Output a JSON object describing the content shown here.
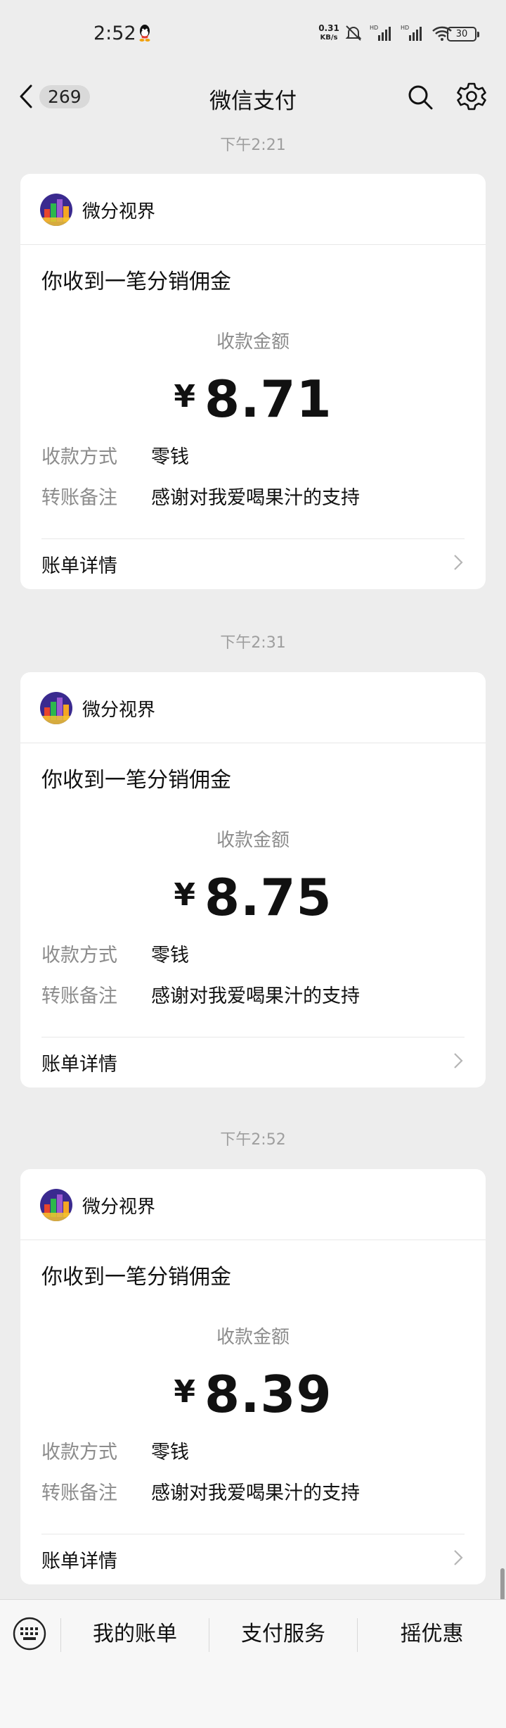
{
  "status_bar": {
    "time": "2:52",
    "net_speed_value": "0.31",
    "net_speed_unit": "KB/s",
    "battery": "30",
    "icons": [
      "qq-icon",
      "mute-icon",
      "hd-signal-icon",
      "hd-signal-icon",
      "wifi-icon",
      "battery-icon"
    ]
  },
  "nav": {
    "unread_count": "269",
    "title": "微信支付",
    "icons": [
      "back-arrow-icon",
      "search-icon",
      "gear-icon"
    ]
  },
  "messages": [
    {
      "timestamp": "下午2:21",
      "merchant": "微分视界",
      "title": "你收到一笔分销佣金",
      "amount_label": "收款金额",
      "currency": "¥",
      "amount": "8.71",
      "method_label": "收款方式",
      "method_value": "零钱",
      "note_label": "转账备注",
      "note_value": "感谢对我爱喝果汁的支持",
      "detail_label": "账单详情"
    },
    {
      "timestamp": "下午2:31",
      "merchant": "微分视界",
      "title": "你收到一笔分销佣金",
      "amount_label": "收款金额",
      "currency": "¥",
      "amount": "8.75",
      "method_label": "收款方式",
      "method_value": "零钱",
      "note_label": "转账备注",
      "note_value": "感谢对我爱喝果汁的支持",
      "detail_label": "账单详情"
    },
    {
      "timestamp": "下午2:52",
      "merchant": "微分视界",
      "title": "你收到一笔分销佣金",
      "amount_label": "收款金额",
      "currency": "¥",
      "amount": "8.39",
      "method_label": "收款方式",
      "method_value": "零钱",
      "note_label": "转账备注",
      "note_value": "感谢对我爱喝果汁的支持",
      "detail_label": "账单详情"
    }
  ],
  "bottom_menu": {
    "items": [
      "我的账单",
      "支付服务",
      "摇优惠"
    ]
  },
  "colors": {
    "background": "#ededed",
    "card": "#ffffff",
    "muted_text": "#8c8c8c"
  }
}
